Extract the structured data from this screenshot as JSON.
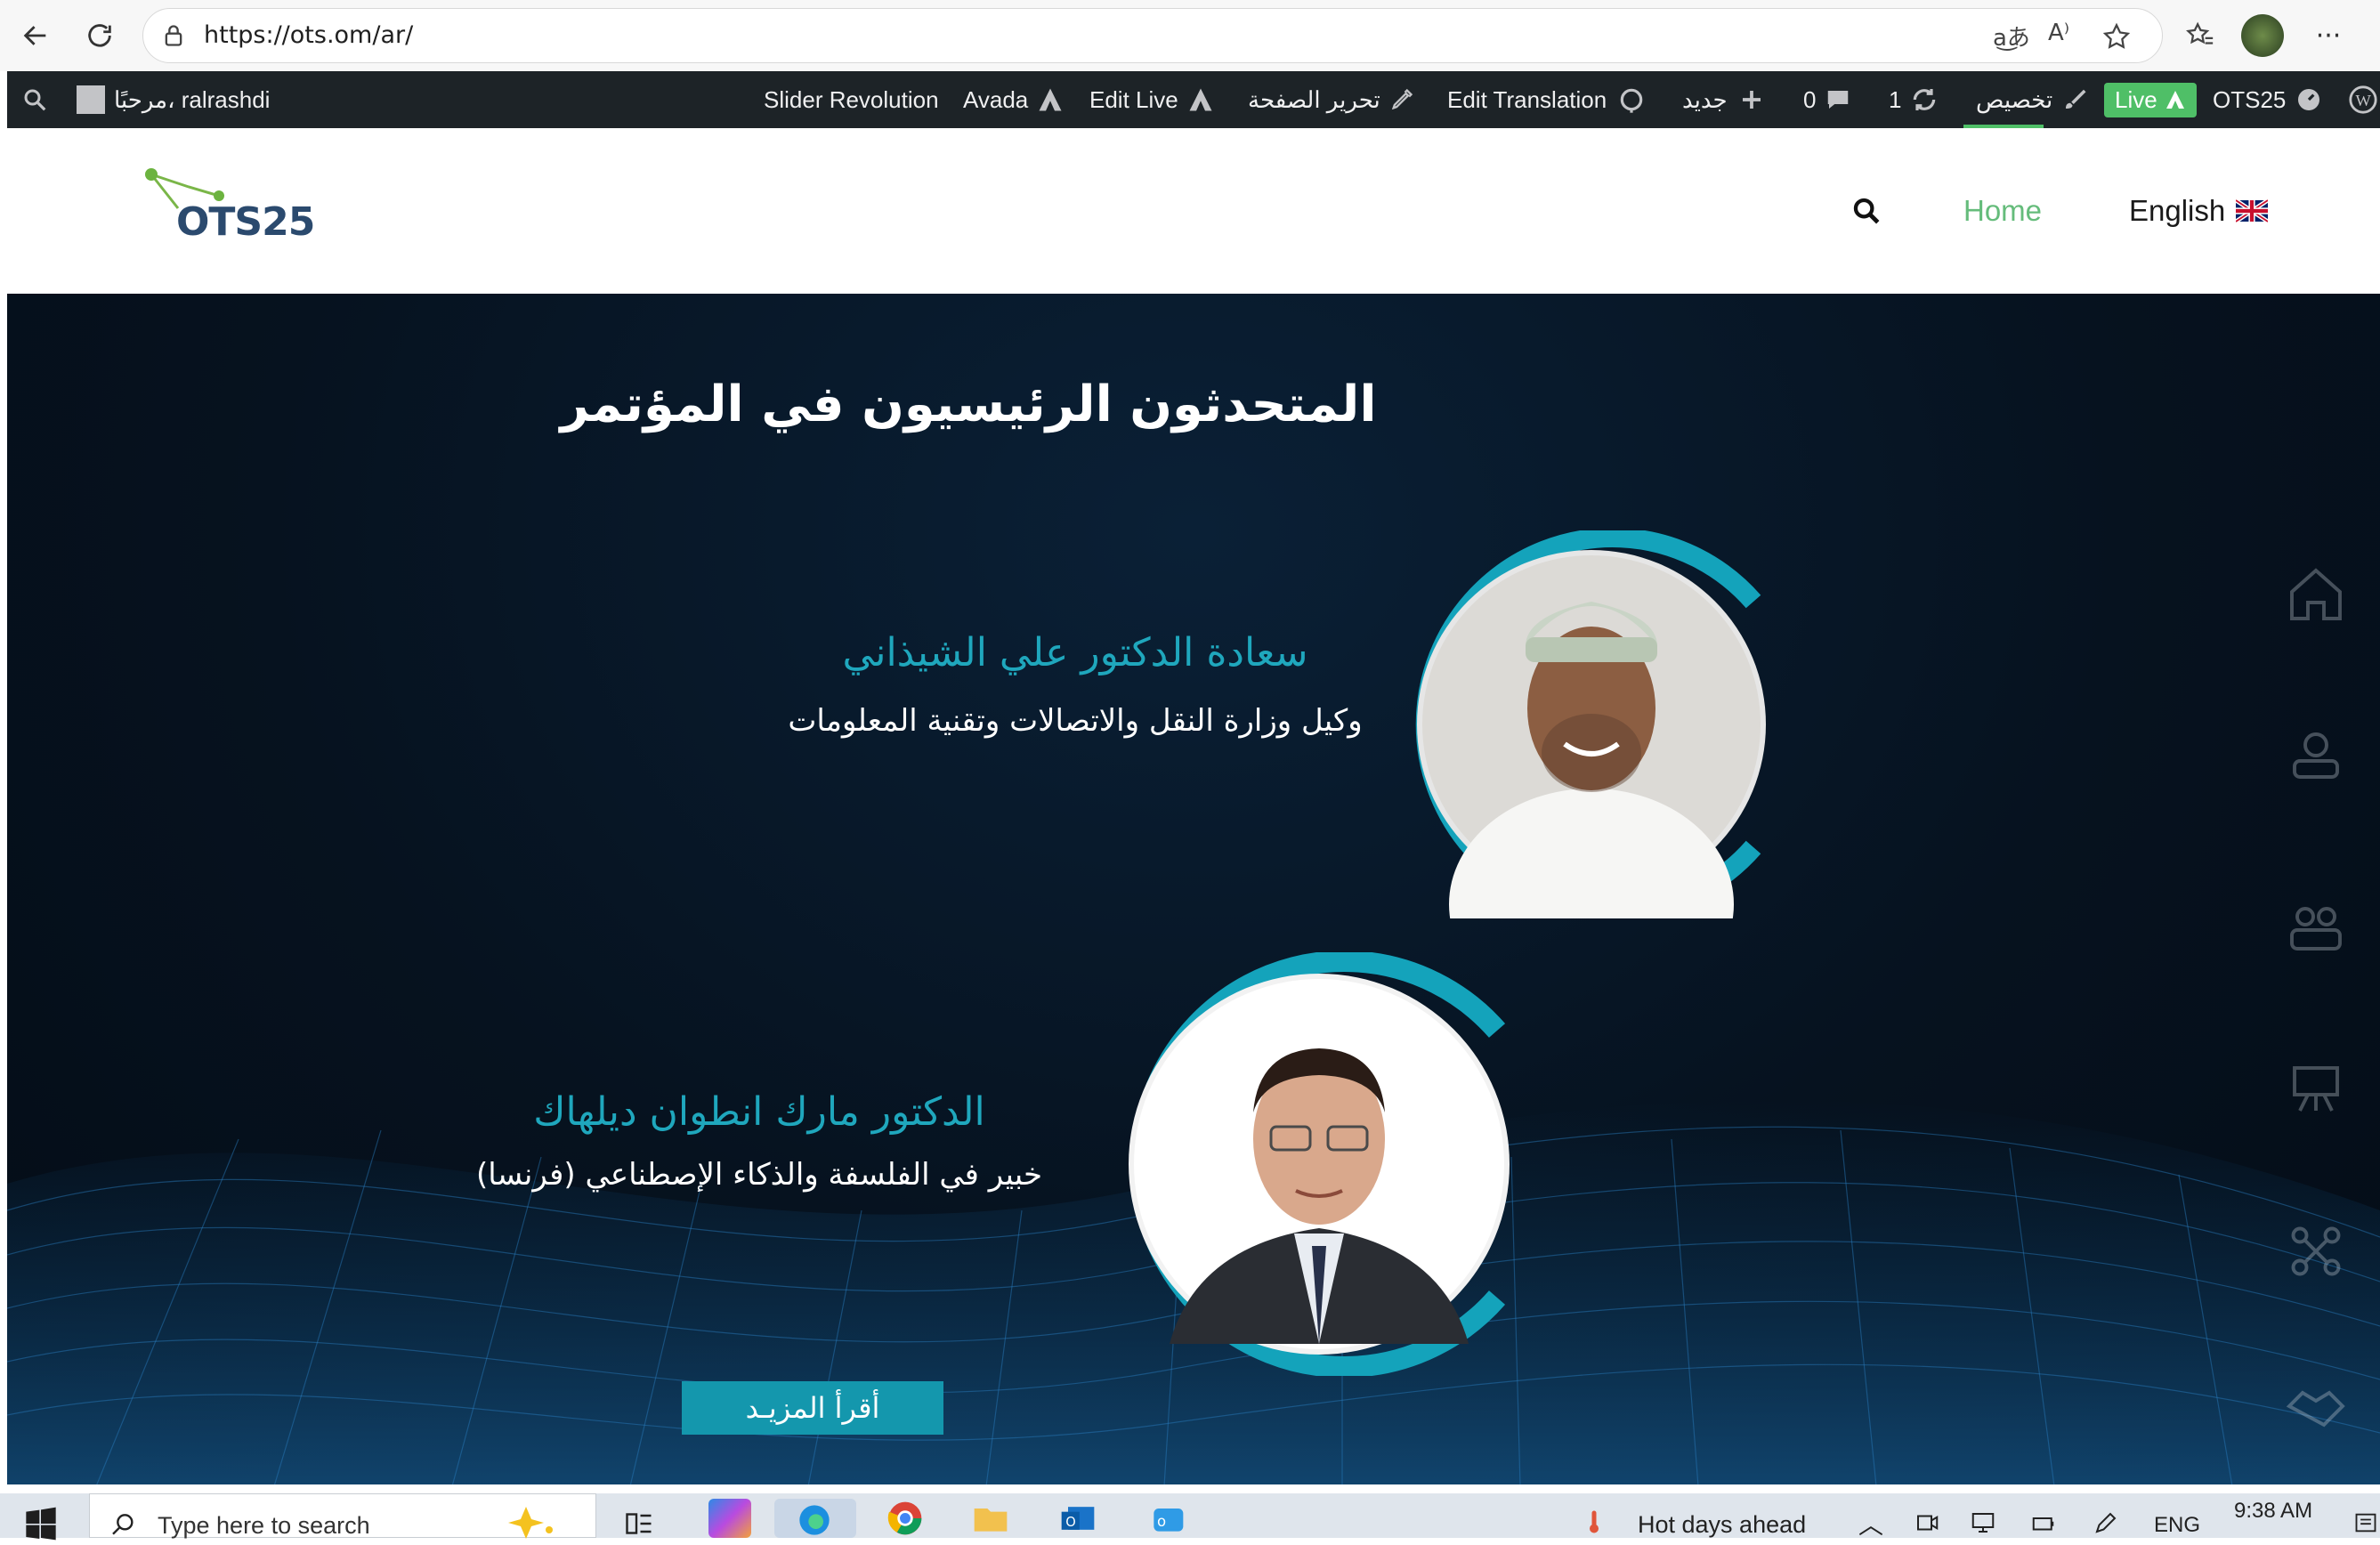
{
  "browser": {
    "url": "https://ots.om/ar/"
  },
  "wp_admin_bar": {
    "greeting": "مرحبًا، ralrashdi",
    "slider_revolution": "Slider Revolution",
    "avada": "Avada",
    "edit_live": "Edit Live",
    "edit_page": "تحرير الصفحة",
    "edit_translation": "Edit Translation",
    "new": "جديد",
    "comments_count": "0",
    "updates_count": "1",
    "customize": "تخصيص",
    "live": "Live",
    "site_name": "OTS25"
  },
  "site_header": {
    "logo_text": "OTS25",
    "nav": {
      "home": "Home",
      "language": "English"
    }
  },
  "hero": {
    "title": "المتحدثون الرئيسيون في المؤتمر",
    "speakers": [
      {
        "name": "سعادة الدكتور علي الشيذاني",
        "role": "وكيل وزارة النقل والاتصالات وتقنية المعلومات"
      },
      {
        "name": "الدكتور مارك انطوان ديلهاك",
        "role": "خبير في الفلسفة والذكاء الإصطناعي (فرنسا)"
      }
    ],
    "read_more": "أقرأ المزيـد"
  },
  "taskbar": {
    "search_placeholder": "Type here to search",
    "weather": "Hot days ahead",
    "language": "ENG",
    "time": "9:38 AM"
  },
  "colors": {
    "accent_teal": "#1fa7bd",
    "wp_green": "#4fbf67",
    "wp_bar": "#1d2327",
    "hero_bg": "#06121f"
  }
}
